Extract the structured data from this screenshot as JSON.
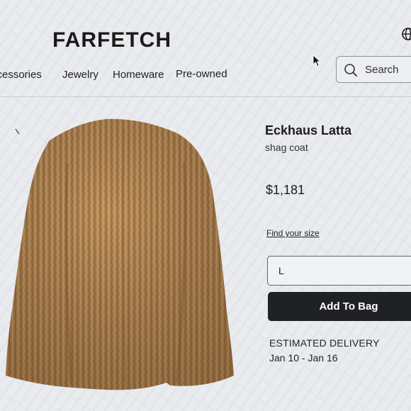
{
  "header": {
    "logo_text": "FARFETCH",
    "nav": [
      {
        "label": "ccessories"
      },
      {
        "label": "Jewelry"
      },
      {
        "label": "Homeware"
      },
      {
        "label": "Pre-owned"
      }
    ],
    "search": {
      "label": "Search",
      "icon": "search-icon"
    },
    "globe_icon": "globe-icon"
  },
  "product": {
    "brand": "Eckhaus Latta",
    "name": "shag coat",
    "price": "$1,181",
    "find_size_label": "Find your size",
    "selected_size": "L",
    "add_to_bag_label": "Add To Bag",
    "delivery_label": "ESTIMATED DELIVERY",
    "delivery_dates": "Jan 10 - Jan 16"
  },
  "colors": {
    "background": "#e9ebee",
    "button": "#1f2124",
    "coat": "#b98a55"
  }
}
